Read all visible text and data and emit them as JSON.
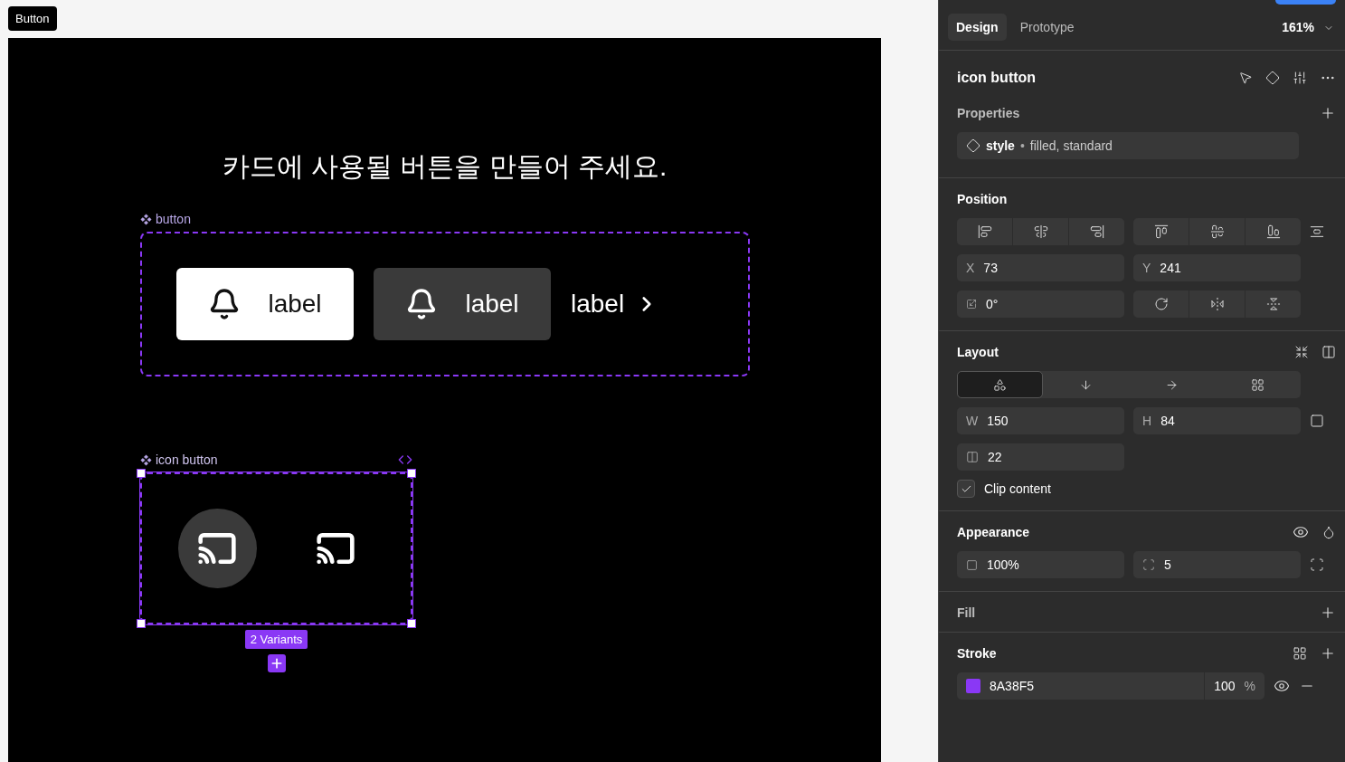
{
  "canvas": {
    "frame_label": "Button",
    "heading": "카드에 사용될 버튼을 만들어 주세요.",
    "components": [
      {
        "name": "button",
        "selected": false,
        "variants": [
          {
            "kind": "filled",
            "label": "label"
          },
          {
            "kind": "tonal",
            "label": "label"
          },
          {
            "kind": "text",
            "label": "label"
          }
        ]
      },
      {
        "name": "icon button",
        "selected": true,
        "variants": [
          {
            "kind": "filled"
          },
          {
            "kind": "standard"
          }
        ],
        "variant_count": "2 Variants"
      }
    ]
  },
  "panel": {
    "tabs": [
      {
        "label": "Design",
        "selected": true
      },
      {
        "label": "Prototype",
        "selected": false
      }
    ],
    "zoom": "161%",
    "layer_title": "icon button",
    "properties": {
      "heading": "Properties",
      "muted": true,
      "items": [
        {
          "name": "style",
          "separator": "•",
          "value": "filled, standard"
        }
      ]
    },
    "position": {
      "heading": "Position",
      "muted": false,
      "x": {
        "label": "X",
        "value": "73"
      },
      "y": {
        "label": "Y",
        "value": "241"
      },
      "rotation": "0°"
    },
    "layout": {
      "heading": "Layout",
      "muted": false,
      "modes": [
        {
          "kind": "freeform",
          "selected": true
        },
        {
          "kind": "vertical",
          "selected": false
        },
        {
          "kind": "horizontal",
          "selected": false
        },
        {
          "kind": "grid",
          "selected": false
        }
      ],
      "w": {
        "label": "W",
        "value": "150"
      },
      "h": {
        "label": "H",
        "value": "84"
      },
      "gap": "22",
      "clip": {
        "label": "Clip content",
        "checked": true
      }
    },
    "appearance": {
      "heading": "Appearance",
      "muted": false,
      "opacity": "100%",
      "radius": "5"
    },
    "fill": {
      "heading": "Fill",
      "muted": true
    },
    "stroke": {
      "heading": "Stroke",
      "muted": false,
      "items": [
        {
          "color": "#8a38f5",
          "hex": "8A38F5",
          "opacity": "100",
          "unit": "%"
        }
      ]
    }
  }
}
